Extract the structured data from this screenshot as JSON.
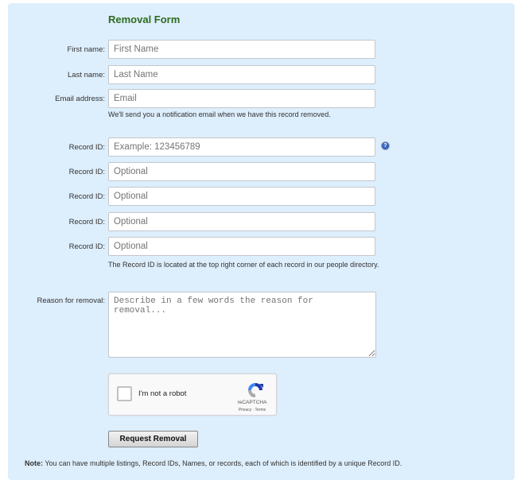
{
  "form": {
    "title": "Removal Form",
    "first_name": {
      "label": "First name:",
      "placeholder": "First Name",
      "value": ""
    },
    "last_name": {
      "label": "Last name:",
      "placeholder": "Last Name",
      "value": ""
    },
    "email": {
      "label": "Email address:",
      "placeholder": "Email",
      "value": "",
      "hint": "We'll send you a notification email when we have this record removed."
    },
    "record_ids": [
      {
        "label": "Record ID:",
        "placeholder": "Example: 123456789"
      },
      {
        "label": "Record ID:",
        "placeholder": "Optional"
      },
      {
        "label": "Record ID:",
        "placeholder": "Optional"
      },
      {
        "label": "Record ID:",
        "placeholder": "Optional"
      },
      {
        "label": "Record ID:",
        "placeholder": "Optional"
      }
    ],
    "record_id_help_icon": "help-icon",
    "record_id_hint": "The Record ID is located at the top right corner of each record in our people directory.",
    "reason": {
      "label": "Reason for removal:",
      "placeholder": "Describe in a few words the reason for removal..."
    },
    "captcha": {
      "label": "I'm not a robot",
      "brand": "reCAPTCHA",
      "links": "Privacy · Terms",
      "checked": false
    },
    "submit_label": "Request Removal",
    "note_prefix": "Note:",
    "note_text": "You can have multiple listings, Record IDs, Names, or records, each of which is identified by a unique Record ID."
  },
  "colors": {
    "panel_bg": "#ddeefc",
    "title": "#2d6b1f"
  }
}
